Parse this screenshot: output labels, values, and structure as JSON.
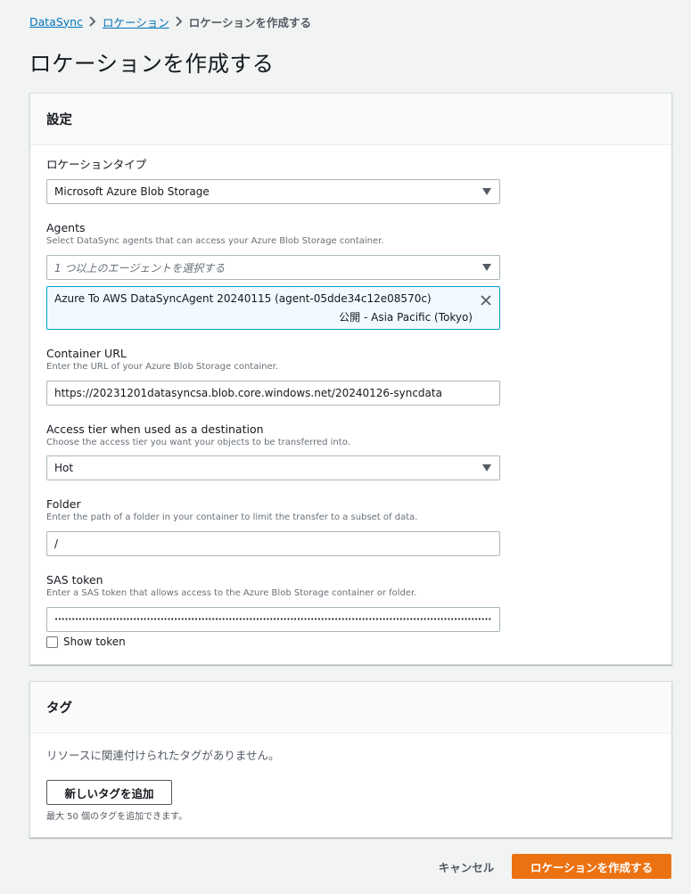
{
  "breadcrumb": {
    "items": [
      "DataSync",
      "ロケーション"
    ],
    "current": "ロケーションを作成する"
  },
  "page_title": "ロケーションを作成する",
  "settings": {
    "title": "設定",
    "location_type": {
      "label": "ロケーションタイプ",
      "value": "Microsoft Azure Blob Storage"
    },
    "agents": {
      "label": "Agents",
      "description": "Select DataSync agents that can access your Azure Blob Storage container.",
      "placeholder": "1 つ以上のエージェントを選択する",
      "selected": {
        "name": "Azure To AWS DataSyncAgent 20240115 (agent-05dde34c12e08570c)",
        "meta": "公開 - Asia Pacific (Tokyo)"
      }
    },
    "container_url": {
      "label": "Container URL",
      "description": "Enter the URL of your Azure Blob Storage container.",
      "value": "https://20231201datasyncsa.blob.core.windows.net/20240126-syncdata"
    },
    "access_tier": {
      "label": "Access tier when used as a destination",
      "description": "Choose the access tier you want your objects to be transferred into.",
      "value": "Hot"
    },
    "folder": {
      "label": "Folder",
      "description": "Enter the path of a folder in your container to limit the transfer to a subset of data.",
      "value": "/"
    },
    "sas_token": {
      "label": "SAS token",
      "description": "Enter a SAS token that allows access to the Azure Blob Storage container or folder.",
      "value": "••••••••••••••••••••••••••••••••••••••••••••••••••••••••••••••••••••••••••••••••••••••••••••••••••••••••••••••••••••••••••••••••••••••••",
      "show_token_label": "Show token"
    }
  },
  "tags": {
    "title": "タグ",
    "empty_text": "リソースに関連付けられたタグがありません。",
    "add_button": "新しいタグを追加",
    "limit_text": "最大 50 個のタグを追加できます。"
  },
  "footer": {
    "cancel": "キャンセル",
    "submit": "ロケーションを作成する"
  },
  "colors": {
    "link": "#0073bb",
    "primary": "#ec7211",
    "selected_border": "#00a1c9"
  }
}
